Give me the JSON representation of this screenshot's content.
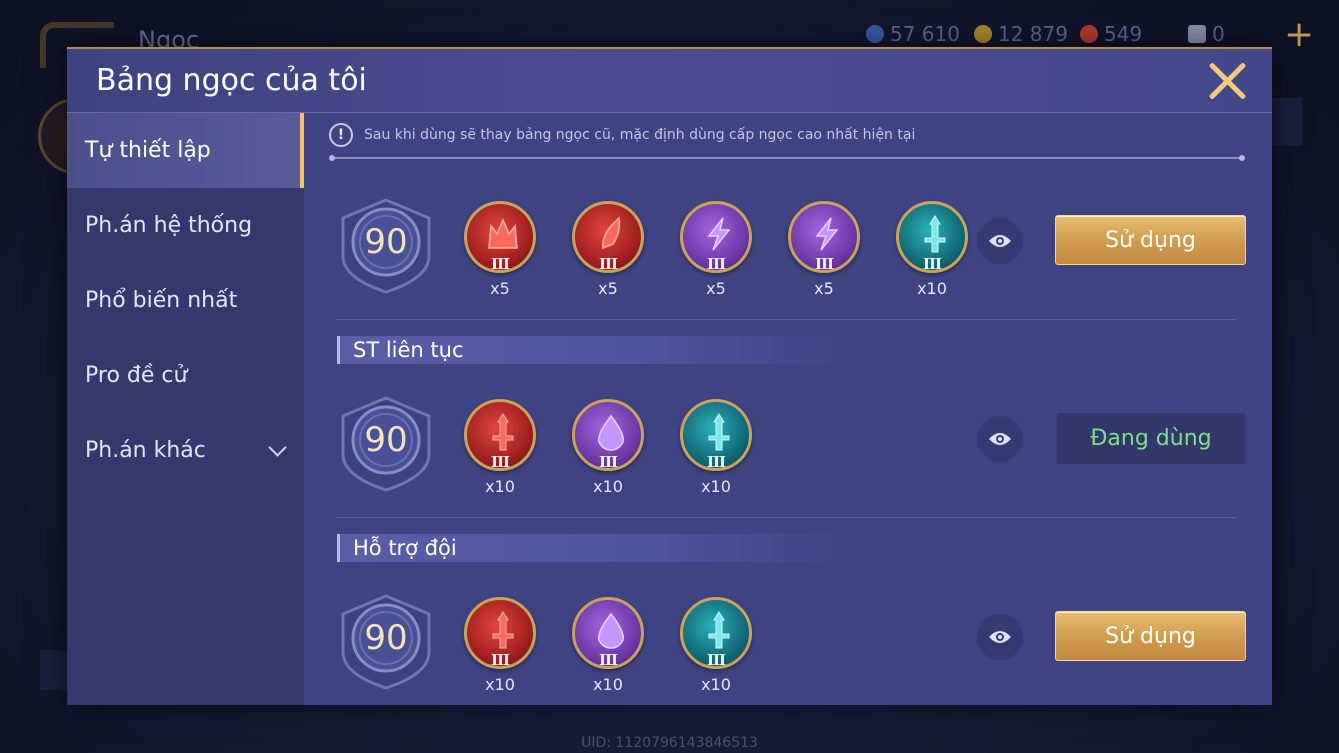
{
  "background": {
    "screen_title": "Ngọc",
    "resources": [
      {
        "name": "gold-coins",
        "value": "57 610",
        "color": "#3a5aa8"
      },
      {
        "name": "vouchers",
        "value": "12 879",
        "color": "#a88a2a"
      },
      {
        "name": "gems",
        "value": "549",
        "color": "#b53a2f"
      },
      {
        "name": "cards",
        "value": "0",
        "color": "#8a8fb0"
      }
    ],
    "uid": "UID: 1120796143846513"
  },
  "modal": {
    "title": "Bảng ngọc của tôi",
    "notice": "Sau khi dùng sẽ thay bảng ngọc cũ, mặc định dùng cấp ngọc cao nhất hiện tại"
  },
  "sidebar": {
    "items": [
      {
        "label": "Tự thiết lập",
        "active": true
      },
      {
        "label": "Ph.án hệ thống",
        "active": false
      },
      {
        "label": "Phổ biến nhất",
        "active": false
      },
      {
        "label": "Pro đề cử",
        "active": false
      },
      {
        "label": "Ph.án khác",
        "active": false,
        "has_dropdown": true
      }
    ]
  },
  "pages": [
    {
      "name": "",
      "level": "90",
      "button": "Sử dụng",
      "button_state": "use",
      "gems": [
        {
          "color": "red",
          "icon": "crown-icon",
          "tier": "III",
          "count": "x5"
        },
        {
          "color": "red",
          "icon": "blade-icon",
          "tier": "III",
          "count": "x5"
        },
        {
          "color": "purple",
          "icon": "lightning-icon",
          "tier": "III",
          "count": "x5"
        },
        {
          "color": "purple",
          "icon": "lightning-icon",
          "tier": "III",
          "count": "x5"
        },
        {
          "color": "teal",
          "icon": "sword-icon",
          "tier": "III",
          "count": "x10"
        }
      ]
    },
    {
      "name": "ST liên tục",
      "level": "90",
      "button": "Đang dùng",
      "button_state": "in-use",
      "gems": [
        {
          "color": "red",
          "icon": "sword-icon",
          "tier": "III",
          "count": "x10"
        },
        {
          "color": "purple",
          "icon": "drop-icon",
          "tier": "III",
          "count": "x10"
        },
        {
          "color": "teal",
          "icon": "sword-icon",
          "tier": "III",
          "count": "x10"
        }
      ]
    },
    {
      "name": "Hỗ trợ đội",
      "level": "90",
      "button": "Sử dụng",
      "button_state": "use",
      "gems": [
        {
          "color": "red",
          "icon": "sword-icon",
          "tier": "III",
          "count": "x10"
        },
        {
          "color": "purple",
          "icon": "drop-icon",
          "tier": "III",
          "count": "x10"
        },
        {
          "color": "teal",
          "icon": "sword-icon",
          "tier": "III",
          "count": "x10"
        }
      ]
    }
  ]
}
